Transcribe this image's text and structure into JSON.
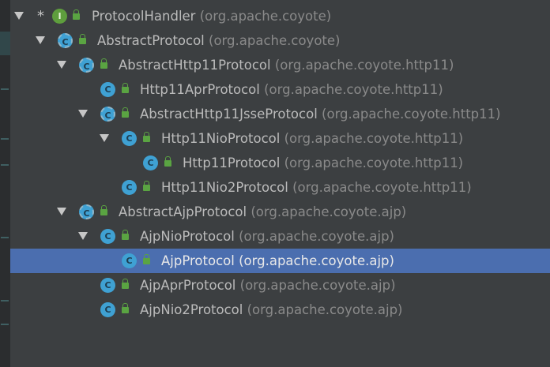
{
  "tree": {
    "rows": [
      {
        "name": "ProtocolHandler",
        "pkg": "(org.apache.coyote)",
        "icon": "interface-icon",
        "icon_letter": "I"
      },
      {
        "name": "AbstractProtocol",
        "pkg": "(org.apache.coyote)",
        "icon": "abstract-class-icon",
        "icon_letter": "C"
      },
      {
        "name": "AbstractHttp11Protocol",
        "pkg": "(org.apache.coyote.http11)",
        "icon": "abstract-class-icon",
        "icon_letter": "C"
      },
      {
        "name": "Http11AprProtocol",
        "pkg": "(org.apache.coyote.http11)",
        "icon": "class-icon",
        "icon_letter": "C"
      },
      {
        "name": "AbstractHttp11JsseProtocol",
        "pkg": "(org.apache.coyote.http11)",
        "icon": "abstract-class-icon",
        "icon_letter": "C"
      },
      {
        "name": "Http11NioProtocol",
        "pkg": "(org.apache.coyote.http11)",
        "icon": "class-icon",
        "icon_letter": "C"
      },
      {
        "name": "Http11Protocol",
        "pkg": "(org.apache.coyote.http11)",
        "icon": "class-icon",
        "icon_letter": "C"
      },
      {
        "name": "Http11Nio2Protocol",
        "pkg": "(org.apache.coyote.http11)",
        "icon": "class-icon",
        "icon_letter": "C"
      },
      {
        "name": "AbstractAjpProtocol",
        "pkg": "(org.apache.coyote.ajp)",
        "icon": "abstract-class-icon",
        "icon_letter": "C"
      },
      {
        "name": "AjpNioProtocol",
        "pkg": "(org.apache.coyote.ajp)",
        "icon": "class-icon",
        "icon_letter": "C"
      },
      {
        "name": "AjpProtocol",
        "pkg": "(org.apache.coyote.ajp)",
        "icon": "class-icon",
        "icon_letter": "C",
        "selected": true
      },
      {
        "name": "AjpAprProtocol",
        "pkg": "(org.apache.coyote.ajp)",
        "icon": "class-icon",
        "icon_letter": "C"
      },
      {
        "name": "AjpNio2Protocol",
        "pkg": "(org.apache.coyote.ajp)",
        "icon": "class-icon",
        "icon_letter": "C"
      }
    ],
    "root_marker": "*",
    "colors": {
      "background": "#3c3f41",
      "selection": "#4b6eaf",
      "class_icon": "#3fa1d3",
      "interface_icon": "#5e9e3d",
      "public_lock": "#5aa442",
      "name_text": "#bbbbbb",
      "package_text": "#8a8a8a"
    }
  }
}
